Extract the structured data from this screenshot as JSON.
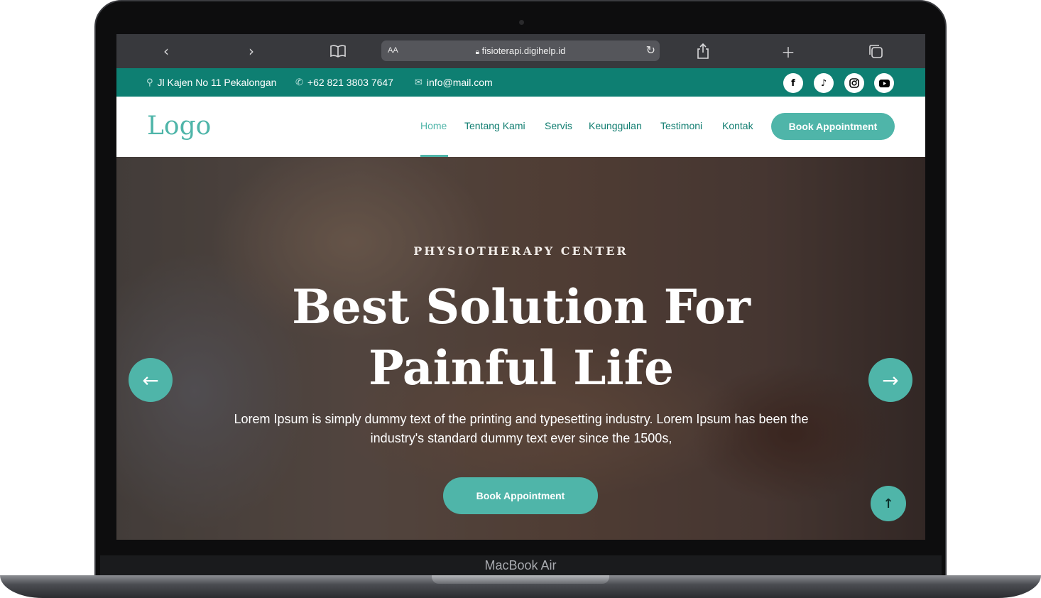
{
  "browser": {
    "url": "fisioterapi.digihelp.id",
    "aa_label": "AA",
    "icons": [
      "back-icon",
      "forward-icon",
      "bookmarks-icon",
      "lock-icon",
      "reload-icon",
      "share-icon",
      "new-tab-icon",
      "tabs-icon"
    ]
  },
  "topbar": {
    "address": "Jl Kajen No 11 Pekalongan",
    "phone": "+62 821 3803 7647",
    "email": "info@mail.com",
    "socials": [
      "facebook-icon",
      "tiktok-icon",
      "instagram-icon",
      "youtube-icon"
    ]
  },
  "navbar": {
    "logo": "Logo",
    "links": [
      "Home",
      "Tentang Kami",
      "Servis",
      "Keunggulan",
      "Testimoni",
      "Kontak"
    ],
    "active": "Home",
    "cta": "Book Appointment"
  },
  "hero": {
    "eyebrow": "PHYSIOTHERAPY CENTER",
    "title": "Best Solution For Painful Life",
    "description": "Lorem Ipsum is simply dummy text of the printing and typesetting industry. Lorem Ipsum has been the industry's standard dummy text ever since the 1500s,",
    "cta": "Book Appointment"
  },
  "device": {
    "label": "MacBook Air"
  },
  "colors": {
    "brand": "#4fb5a9",
    "topbar": "#0e7f72",
    "nav_text": "#107d70"
  }
}
